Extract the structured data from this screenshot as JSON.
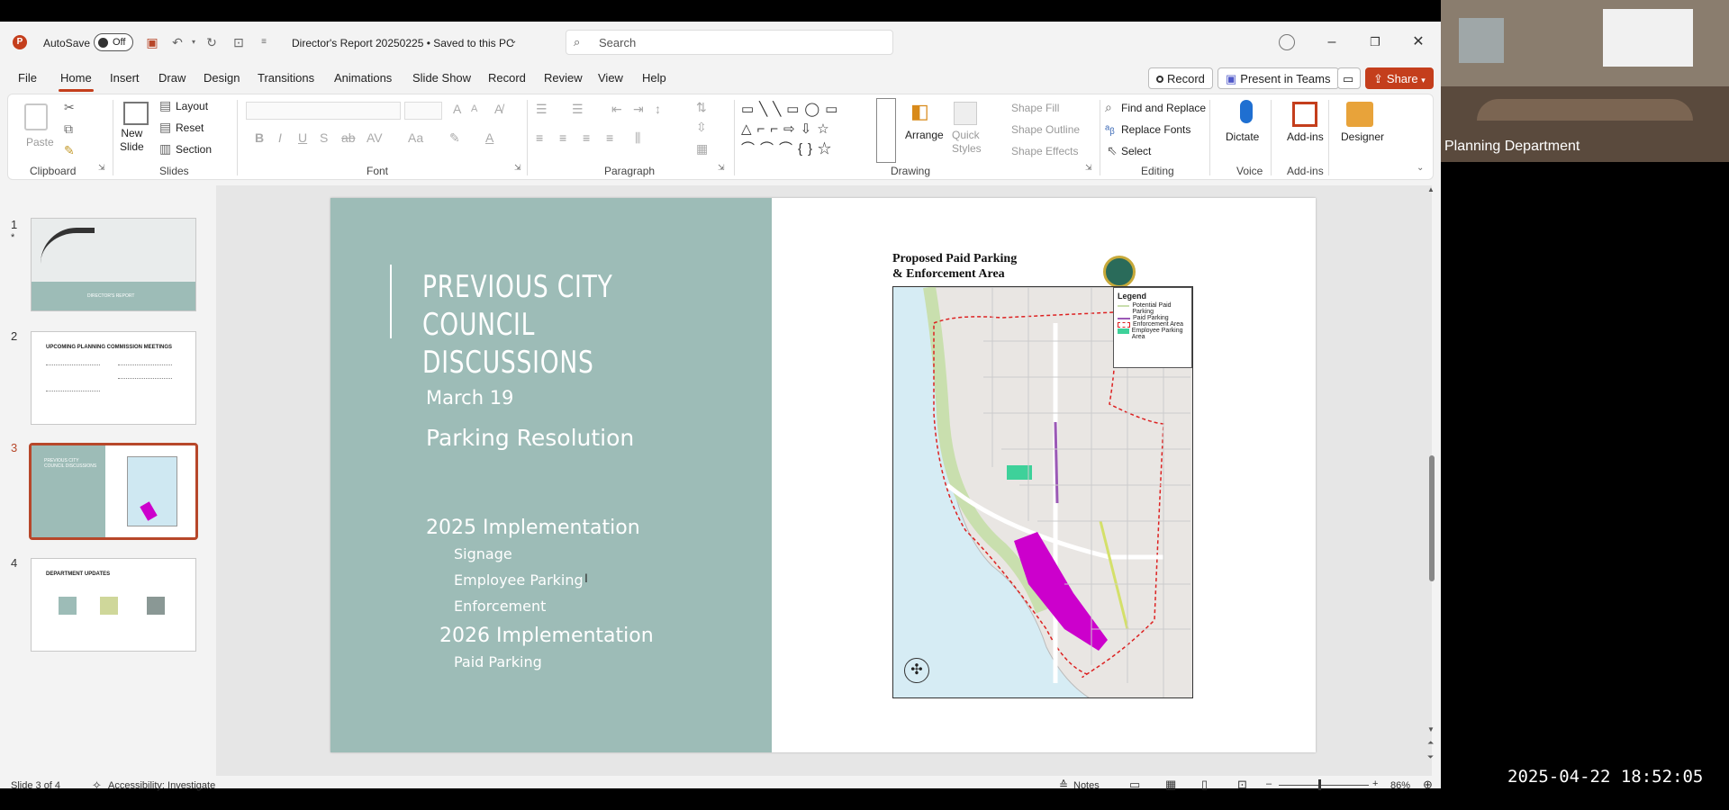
{
  "titlebar": {
    "autosave_label": "AutoSave",
    "autosave_state": "Off",
    "doc_title": "Director's Report 20250225 • Saved to this PC",
    "search_placeholder": "Search"
  },
  "menu": {
    "items": [
      "File",
      "Home",
      "Insert",
      "Draw",
      "Design",
      "Transitions",
      "Animations",
      "Slide Show",
      "Record",
      "Review",
      "View",
      "Help"
    ],
    "active": "Home",
    "record_label": "Record",
    "present_label": "Present in Teams",
    "share_label": "Share"
  },
  "ribbon": {
    "clipboard": {
      "paste": "Paste",
      "label": "Clipboard"
    },
    "slides": {
      "new_slide": "New\nSlide",
      "layout": "Layout",
      "reset": "Reset",
      "section": "Section",
      "label": "Slides"
    },
    "font": {
      "label": "Font"
    },
    "paragraph": {
      "label": "Paragraph"
    },
    "drawing": {
      "arrange": "Arrange",
      "quick_styles": "Quick\nStyles",
      "shape_fill": "Shape Fill",
      "shape_outline": "Shape Outline",
      "shape_effects": "Shape Effects",
      "label": "Drawing"
    },
    "editing": {
      "find_replace": "Find and Replace",
      "replace_fonts": "Replace Fonts",
      "select": "Select",
      "label": "Editing"
    },
    "voice": {
      "dictate": "Dictate",
      "label": "Voice"
    },
    "addins": {
      "addins": "Add-ins",
      "label": "Add-ins"
    },
    "designer": {
      "designer": "Designer"
    }
  },
  "thumbnails": [
    {
      "num": "1",
      "star": "*",
      "caption": "DIRECTOR'S REPORT"
    },
    {
      "num": "2",
      "caption": "UPCOMING PLANNING COMMISSION MEETINGS"
    },
    {
      "num": "3",
      "caption": "PREVIOUS CITY COUNCIL DISCUSSIONS"
    },
    {
      "num": "4",
      "caption": "DEPARTMENT UPDATES"
    }
  ],
  "slide": {
    "title": "PREVIOUS CITY COUNCIL DISCUSSIONS",
    "date": "March 19",
    "item1": "Parking Resolution",
    "impl2025": "2025 Implementation",
    "sub1": "Signage",
    "sub2": "Employee Parking",
    "sub3": "Enforcement",
    "impl2026": "2026 Implementation",
    "sub4": "Paid Parking",
    "map_title_1": "Proposed Paid Parking",
    "map_title_2": "& Enforcement Area",
    "legend": {
      "title": "Legend",
      "items": [
        "Potential Paid Parking",
        "Paid Parking",
        "Enforcement Area",
        "Employee Parking Area"
      ]
    }
  },
  "status": {
    "slide_of": "Slide 3 of 4",
    "accessibility": "Accessibility: Investigate",
    "notes": "Notes",
    "zoom": "86%"
  },
  "video": {
    "label": "Planning Department"
  },
  "timestamp": "2025-04-22 18:52:05",
  "colors": {
    "accent": "#c43e1c",
    "slide_teal": "#9dbcb7",
    "share_red": "#c43e1c",
    "purple": "#cc00cc",
    "green": "#3ed19a"
  }
}
